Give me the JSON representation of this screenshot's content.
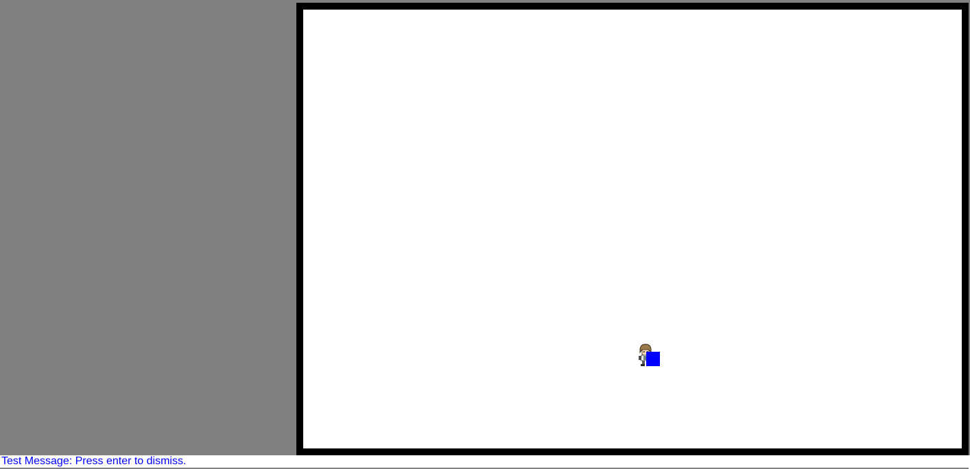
{
  "game": {
    "background_color": "#808080",
    "frame_color": "#000000",
    "canvas_color": "#ffffff",
    "player": {
      "sprite": "character-sprite-icon"
    },
    "marker": {
      "color": "#0000ff"
    }
  },
  "message": {
    "text": "Test Message: Press enter to dismiss.",
    "color": "#0000ff"
  }
}
